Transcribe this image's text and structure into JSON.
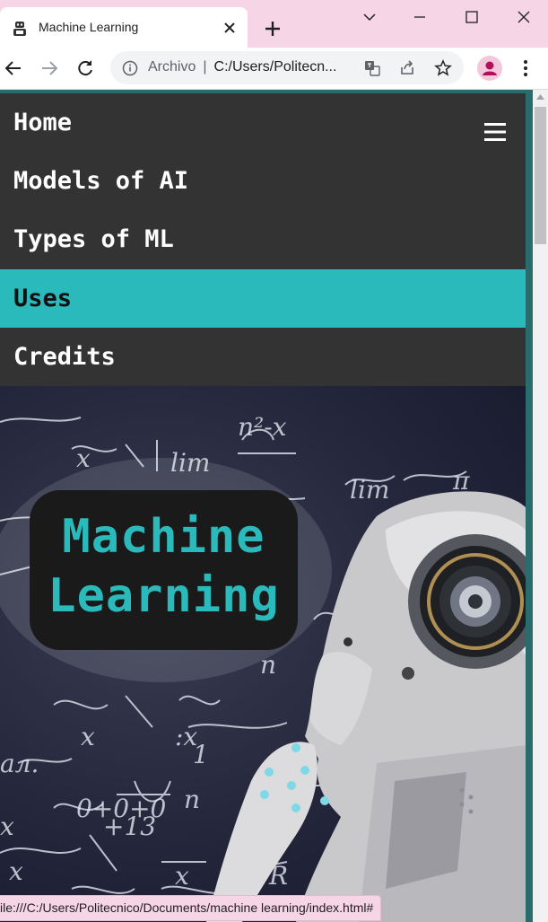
{
  "browser": {
    "tab_title": "Machine Learning",
    "omnibox": {
      "security_label": "Archivo",
      "separator": "|",
      "url": "C:/Users/Politecn..."
    },
    "status_url": "ile:///C:/Users/Politecnico/Documents/machine learning/index.html#",
    "colors": {
      "tabstrip": "#f6d5e6",
      "omnibox": "#f1f3f4"
    }
  },
  "page": {
    "nav": {
      "items": [
        {
          "label": "Home",
          "active": false
        },
        {
          "label": "Models of AI",
          "active": false
        },
        {
          "label": "Types of ML",
          "active": false
        },
        {
          "label": "Uses",
          "active": true
        },
        {
          "label": "Credits",
          "active": false
        }
      ]
    },
    "hero": {
      "title_line1": "Machine",
      "title_line2": "Learning"
    },
    "colors": {
      "navbar": "#333333",
      "accent": "#2bbabb",
      "border": "#2a6b6c"
    }
  }
}
